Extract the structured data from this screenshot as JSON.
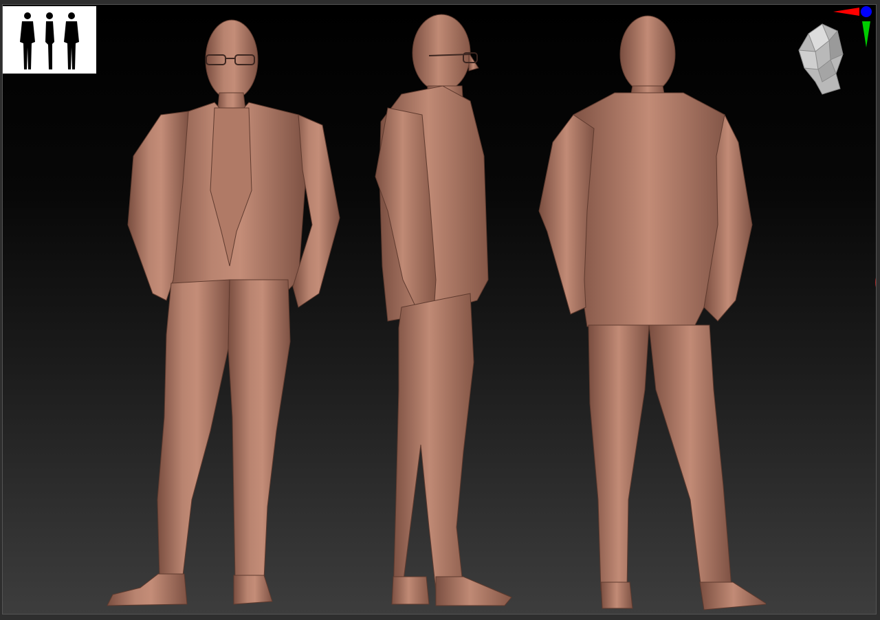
{
  "viewport": {
    "background_top": "#000000",
    "background_bottom": "#3d3d3d",
    "clay_color": "#b07a66",
    "clay_shadow": "#7a4e40",
    "clay_highlight": "#d6a08a"
  },
  "thumbnail": {
    "icon": "silhouette-views-icon",
    "views": [
      "front",
      "side",
      "back"
    ]
  },
  "model_views": [
    "front",
    "side",
    "back"
  ],
  "gizmo": {
    "x_axis_color": "#ff0000",
    "y_axis_color": "#00cc00",
    "z_axis_color": "#0000ff",
    "head_icon": "orientation-head-icon"
  }
}
